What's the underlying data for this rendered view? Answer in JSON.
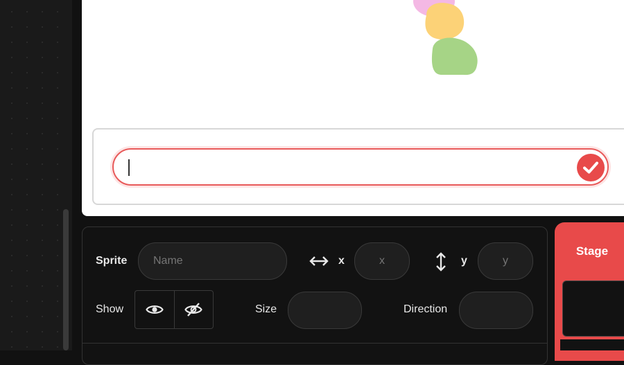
{
  "answer_input": {
    "value": ""
  },
  "sprite_info": {
    "sprite_label": "Sprite",
    "name_placeholder": "Name",
    "x_label": "x",
    "x_placeholder": "x",
    "y_label": "y",
    "y_placeholder": "y",
    "show_label": "Show",
    "size_label": "Size",
    "direction_label": "Direction"
  },
  "stage_tab": {
    "label": "Stage"
  },
  "colors": {
    "accent": "#e84a4a",
    "panel_bg": "#121212",
    "stage_bg": "#ffffff",
    "sprite_pink": "#f4b8e4",
    "sprite_yellow": "#fcd277",
    "sprite_green": "#a6d486"
  },
  "icons": {
    "submit": "check-icon",
    "x_arrow": "horizontal-arrows-icon",
    "y_arrow": "vertical-arrows-icon",
    "show": "eye-icon",
    "hide": "eye-slash-icon"
  }
}
